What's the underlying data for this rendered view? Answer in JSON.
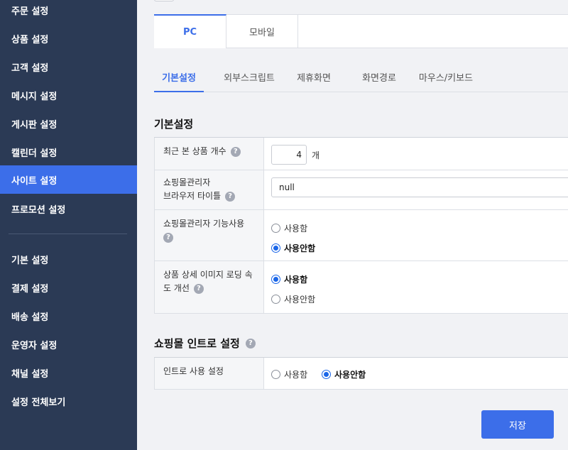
{
  "sidebar": {
    "items": [
      {
        "label": "주문 설정"
      },
      {
        "label": "상품 설정"
      },
      {
        "label": "고객 설정"
      },
      {
        "label": "메시지 설정"
      },
      {
        "label": "게시판 설정"
      },
      {
        "label": "캘린더 설정"
      },
      {
        "label": "사이트 설정",
        "active": true
      },
      {
        "label": "프로모션 설정"
      }
    ],
    "items2": [
      {
        "label": "기본 설정"
      },
      {
        "label": "결제 설정"
      },
      {
        "label": "배송 설정"
      },
      {
        "label": "운영자 설정"
      },
      {
        "label": "채널 설정"
      },
      {
        "label": "설정 전체보기"
      }
    ],
    "colors": {
      "background": "#2b3a55",
      "active": "#3c6ee9"
    }
  },
  "device_tabs": {
    "pc": "PC",
    "mobile": "모바일"
  },
  "sub_tabs": [
    "기본설정",
    "외부스크립트",
    "제휴화면",
    "화면경로",
    "마우스/키보드"
  ],
  "basic_section": {
    "title": "기본설정",
    "help_icon": "?",
    "rows": {
      "recent_products": {
        "label": "최근 본 상품 개수",
        "value": "4",
        "unit": "개"
      },
      "admin_title": {
        "label_line1": "쇼핑몰관리자",
        "label_line2": "브라우저 타이틀",
        "value": "null"
      },
      "admin_feature": {
        "label": "쇼핑몰관리자 기능사용",
        "opt_use": "사용함",
        "opt_unuse": "사용안함",
        "selected": "사용안함"
      },
      "image_loading": {
        "label_line1": "상품 상세 이미지 로딩 속",
        "label_line2": "도 개선",
        "opt_use": "사용함",
        "opt_unuse": "사용안함",
        "selected": "사용함"
      }
    }
  },
  "intro_section": {
    "title": "쇼핑몰 인트로 설정",
    "row": {
      "label": "인트로 사용 설정",
      "opt_use": "사용함",
      "opt_unuse": "사용안함",
      "selected": "사용안함"
    }
  },
  "save_button": "저장",
  "colors": {
    "accent": "#3c6ee9",
    "radio": "#1a66e8"
  }
}
